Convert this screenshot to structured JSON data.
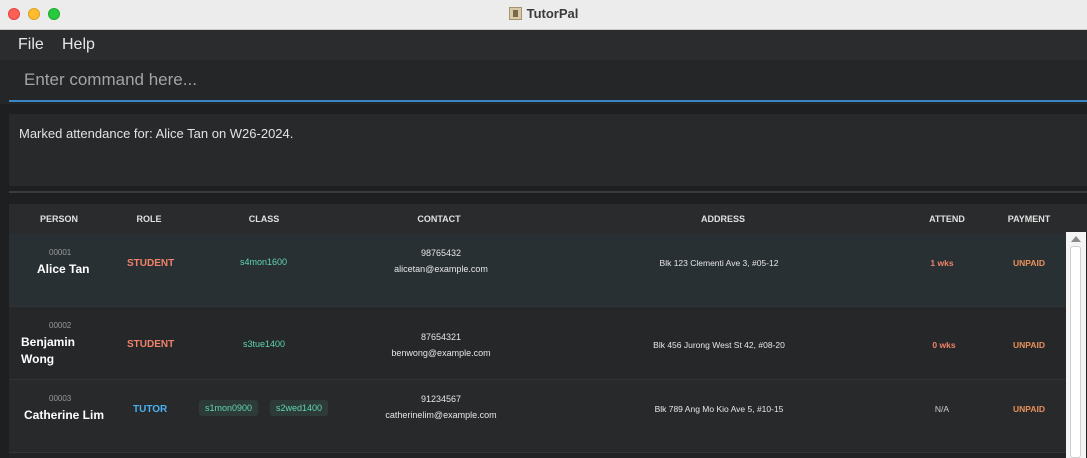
{
  "window": {
    "title": "TutorPal"
  },
  "menu": {
    "file": "File",
    "help": "Help"
  },
  "command": {
    "placeholder": "Enter command here...",
    "value": ""
  },
  "result": {
    "text": "Marked attendance for: Alice Tan on W26-2024."
  },
  "table": {
    "headers": {
      "person": "PERSON",
      "role": "ROLE",
      "class": "CLASS",
      "contact": "CONTACT",
      "address": "ADDRESS",
      "attend": "ATTEND",
      "payment": "PAYMENT"
    },
    "rows": [
      {
        "id": "00001",
        "name": "Alice Tan",
        "role": "STUDENT",
        "classes": [
          "s4mon1600"
        ],
        "phone": "98765432",
        "email": "alicetan@example.com",
        "address": "Blk 123 Clementi Ave 3, #05-12",
        "attend": "1 wks",
        "payment": "UNPAID"
      },
      {
        "id": "00002",
        "name_line1": "Benjamin",
        "name_line2": "Wong",
        "role": "STUDENT",
        "classes": [
          "s3tue1400"
        ],
        "phone": "87654321",
        "email": "benwong@example.com",
        "address": "Blk 456 Jurong West St 42, #08-20",
        "attend": "0 wks",
        "payment": "UNPAID"
      },
      {
        "id": "00003",
        "name": "Catherine Lim",
        "role": "TUTOR",
        "classes": [
          "s1mon0900",
          "s2wed1400"
        ],
        "phone": "91234567",
        "email": "catherinelim@example.com",
        "address": "Blk 789 Ang Mo Kio Ave 5, #10-15",
        "attend": "N/A",
        "payment": "UNPAID"
      }
    ]
  },
  "colors": {
    "accent": "#3a86c8",
    "student": "#f0826a",
    "tutor": "#4ab0f0",
    "class": "#5ed6b0",
    "unpaid": "#e8905a"
  }
}
